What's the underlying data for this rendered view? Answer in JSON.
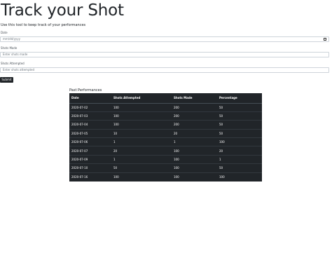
{
  "header": {
    "title": "Track your Shot",
    "subtitle": "Use this tool to keep track of your performances"
  },
  "form": {
    "date": {
      "label": "Date",
      "placeholder": "mm/dd/yyyy"
    },
    "shots_made": {
      "label": "Shots Made",
      "placeholder": "Enter shots made"
    },
    "shots_attempted": {
      "label": "Shots Attempted",
      "placeholder": "Enter shots attempted"
    },
    "submit_label": "Submit"
  },
  "performances": {
    "title": "Past Performances",
    "columns": [
      "Date",
      "Shots Attempted",
      "Shots Made",
      "Percentage"
    ],
    "rows": [
      [
        "2020-07-02",
        "100",
        "200",
        "50"
      ],
      [
        "2020-07-03",
        "100",
        "200",
        "50"
      ],
      [
        "2020-07-04",
        "100",
        "200",
        "50"
      ],
      [
        "2020-07-05",
        "10",
        "20",
        "50"
      ],
      [
        "2020-07-06",
        "1",
        "1",
        "100"
      ],
      [
        "2020-07-07",
        "20",
        "100",
        "20"
      ],
      [
        "2020-07-09",
        "1",
        "100",
        "1"
      ],
      [
        "2020-07-10",
        "50",
        "100",
        "50"
      ],
      [
        "2020-07-16",
        "100",
        "100",
        "100"
      ]
    ]
  },
  "colors": {
    "table_bg": "#212529",
    "button_bg": "#212529",
    "input_border": "#ced4da"
  }
}
